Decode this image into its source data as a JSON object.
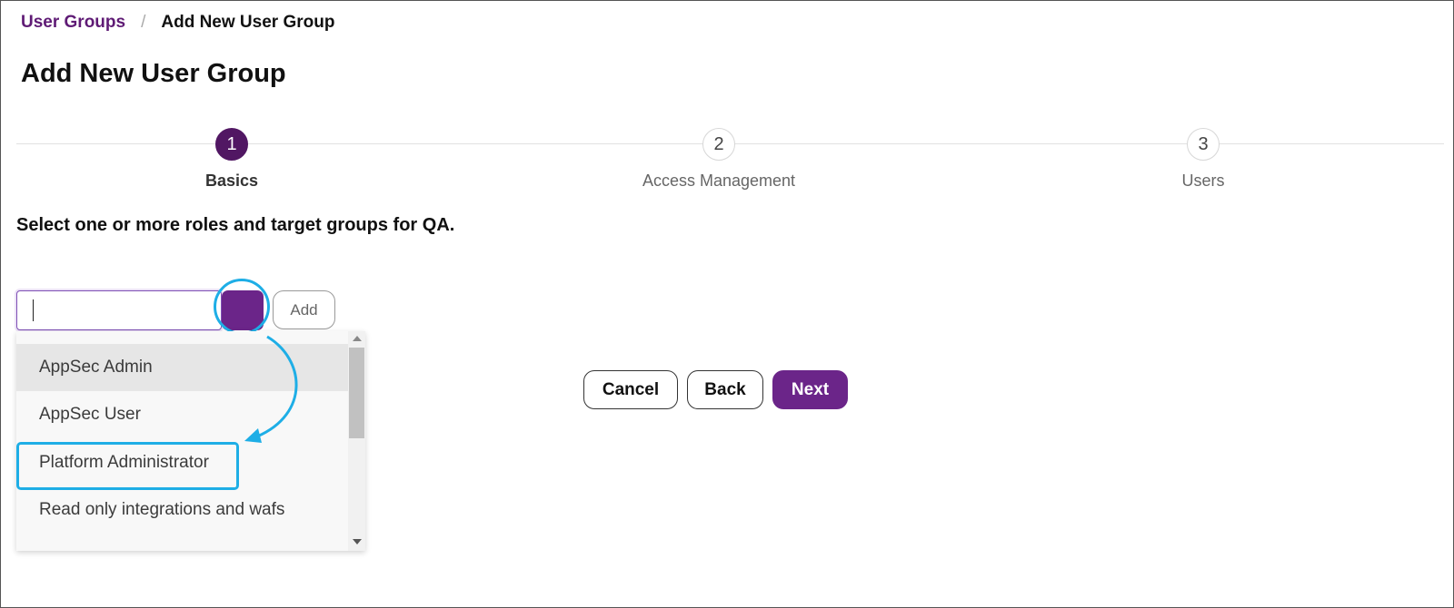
{
  "breadcrumb": {
    "parent": "User Groups",
    "separator": "/",
    "current": "Add New User Group"
  },
  "page_title": "Add New User Group",
  "stepper": {
    "active_step": 1,
    "steps": [
      {
        "number": "1",
        "label": "Basics"
      },
      {
        "number": "2",
        "label": "Access Management"
      },
      {
        "number": "3",
        "label": "Users"
      }
    ]
  },
  "instruction": "Select one or more roles and target groups for QA.",
  "role_picker": {
    "input_value": "",
    "add_label": "Add",
    "options": [
      "AppSec Admin",
      "AppSec User",
      "Platform Administrator",
      "Read only integrations and wafs"
    ],
    "hovered_option": "AppSec Admin",
    "highlighted_option": "Platform Administrator"
  },
  "actions": {
    "cancel_label": "Cancel",
    "back_label": "Back",
    "next_label": "Next"
  },
  "colors": {
    "brand_purple": "#6b2589",
    "step_active": "#511763",
    "annotation_blue": "#1eaee6"
  }
}
